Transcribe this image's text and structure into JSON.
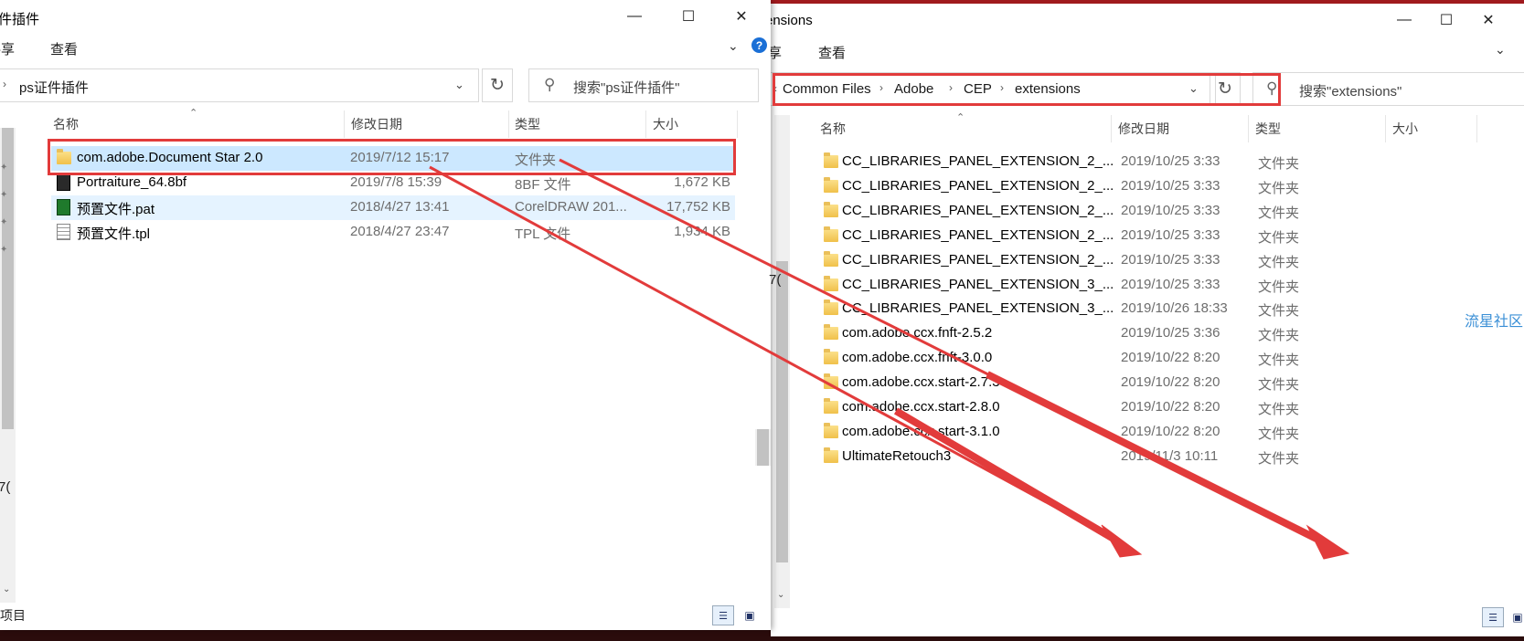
{
  "left_window": {
    "title": "件插件",
    "menu": [
      "共享",
      "查看"
    ],
    "address": "ps证件插件",
    "search_placeholder": "搜索\"ps证件插件\"",
    "columns": [
      "名称",
      "修改日期",
      "类型",
      "大小"
    ],
    "files": [
      {
        "name": "com.adobe.Document Star 2.0",
        "date": "2019/7/12 15:17",
        "type": "文件夹",
        "size": "",
        "icon": "folder-icon"
      },
      {
        "name": "Portraiture_64.8bf",
        "date": "2019/7/8 15:39",
        "type": "8BF 文件",
        "size": "1,672 KB",
        "icon": "plugin-file-icon"
      },
      {
        "name": "预置文件.pat",
        "date": "2018/4/27 13:41",
        "type": "CorelDRAW 201...",
        "size": "17,752 KB",
        "icon": "coreldraw-file-icon"
      },
      {
        "name": "预置文件.tpl",
        "date": "2018/4/27 23:47",
        "type": "TPL 文件",
        "size": "1,934 KB",
        "icon": "text-file-icon"
      }
    ],
    "status": "项目",
    "left_fragment": "7("
  },
  "right_window": {
    "title": "ensions",
    "menu": [
      "共享",
      "查看"
    ],
    "breadcrumb": [
      "Common Files",
      "Adobe",
      "CEP",
      "extensions"
    ],
    "search_placeholder": "搜索\"extensions\"",
    "columns": [
      "名称",
      "修改日期",
      "类型",
      "大小"
    ],
    "files": [
      {
        "name": "CC_LIBRARIES_PANEL_EXTENSION_2_...",
        "date": "2019/10/25 3:33",
        "type": "文件夹"
      },
      {
        "name": "CC_LIBRARIES_PANEL_EXTENSION_2_...",
        "date": "2019/10/25 3:33",
        "type": "文件夹"
      },
      {
        "name": "CC_LIBRARIES_PANEL_EXTENSION_2_...",
        "date": "2019/10/25 3:33",
        "type": "文件夹"
      },
      {
        "name": "CC_LIBRARIES_PANEL_EXTENSION_2_...",
        "date": "2019/10/25 3:33",
        "type": "文件夹"
      },
      {
        "name": "CC_LIBRARIES_PANEL_EXTENSION_2_...",
        "date": "2019/10/25 3:33",
        "type": "文件夹"
      },
      {
        "name": "CC_LIBRARIES_PANEL_EXTENSION_3_...",
        "date": "2019/10/25 3:33",
        "type": "文件夹"
      },
      {
        "name": "CC_LIBRARIES_PANEL_EXTENSION_3_...",
        "date": "2019/10/26 18:33",
        "type": "文件夹"
      },
      {
        "name": "com.adobe.ccx.fnft-2.5.2",
        "date": "2019/10/25 3:36",
        "type": "文件夹"
      },
      {
        "name": "com.adobe.ccx.fnft-3.0.0",
        "date": "2019/10/22 8:20",
        "type": "文件夹"
      },
      {
        "name": "com.adobe.ccx.start-2.7.3",
        "date": "2019/10/22 8:20",
        "type": "文件夹"
      },
      {
        "name": "com.adobe.ccx.start-2.8.0",
        "date": "2019/10/22 8:20",
        "type": "文件夹"
      },
      {
        "name": "com.adobe.ccx.start-3.1.0",
        "date": "2019/10/22 8:20",
        "type": "文件夹"
      },
      {
        "name": "UltimateRetouch3",
        "date": "2019/11/3 10:11",
        "type": "文件夹"
      }
    ],
    "fragment": "7("
  },
  "watermark": "流星社区",
  "colors": {
    "selection": "#cce8ff",
    "hover": "#e5f3ff",
    "annotation": "#e23b3b",
    "accent": "#1a6fd6"
  }
}
